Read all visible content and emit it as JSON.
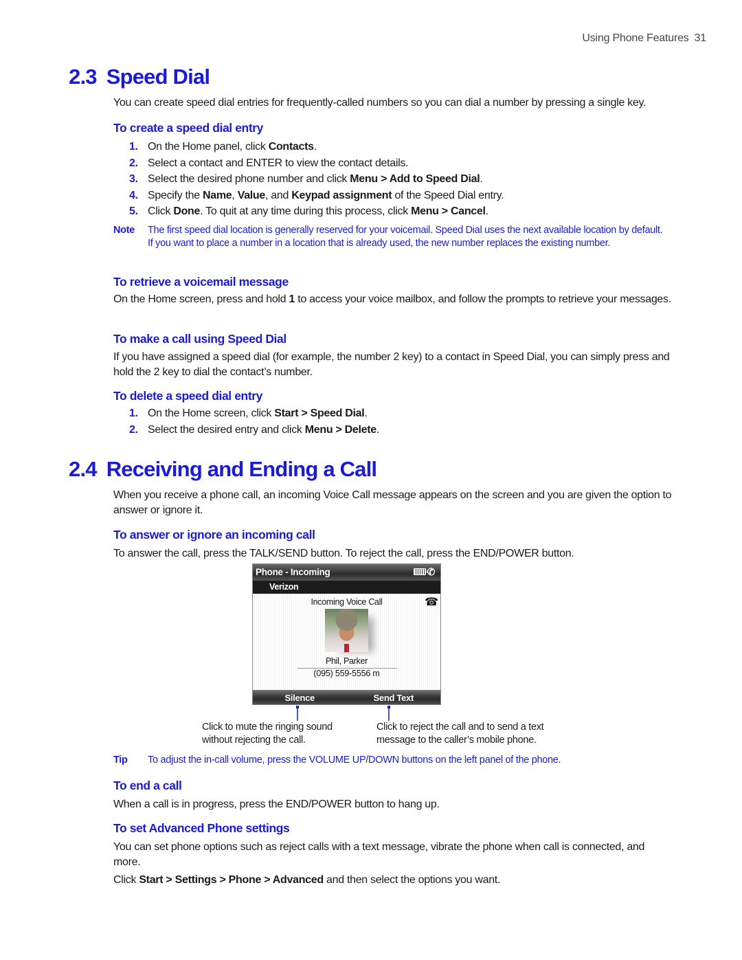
{
  "header": {
    "chapter": "Using Phone Features",
    "page": "31"
  },
  "sections": [
    {
      "number": "2.3",
      "title": "Speed Dial",
      "intro": "You can create speed dial entries for frequently-called numbers so you can dial a number by pressing a single key.",
      "create": {
        "heading": "To create a speed dial entry",
        "steps": [
          {
            "n": "1.",
            "parts": [
              [
                "On the Home panel, click ",
                false
              ],
              [
                "Contacts",
                true
              ],
              [
                ".",
                false
              ]
            ]
          },
          {
            "n": "2.",
            "parts": [
              [
                "Select a contact and ENTER to view the contact details.",
                false
              ]
            ]
          },
          {
            "n": "3.",
            "parts": [
              [
                "Select the desired phone number and click ",
                false
              ],
              [
                "Menu > Add to Speed Dial",
                true
              ],
              [
                ".",
                false
              ]
            ]
          },
          {
            "n": "4.",
            "parts": [
              [
                "Specify the ",
                false
              ],
              [
                "Name",
                true
              ],
              [
                ", ",
                false
              ],
              [
                "Value",
                true
              ],
              [
                ", and ",
                false
              ],
              [
                "Keypad assignment",
                true
              ],
              [
                " of the Speed Dial entry.",
                false
              ]
            ]
          },
          {
            "n": "5.",
            "parts": [
              [
                "Click ",
                false
              ],
              [
                "Done",
                true
              ],
              [
                ". To quit at any time during this process, click ",
                false
              ],
              [
                "Menu > Cancel",
                true
              ],
              [
                ".",
                false
              ]
            ]
          }
        ],
        "note_label": "Note",
        "note": "The first speed dial location is generally reserved for your voicemail. Speed Dial uses the next available location by default. If you want to place a number in a location that is already used, the new number replaces the existing number."
      },
      "voicemail": {
        "heading": "To retrieve a voicemail message",
        "parts": [
          [
            "On the Home screen, press and hold ",
            false
          ],
          [
            "1",
            true
          ],
          [
            " to access your voice mailbox, and follow the prompts to retrieve your messages.",
            false
          ]
        ]
      },
      "make_call": {
        "heading": "To make a call using Speed Dial",
        "text": "If you have assigned a speed dial (for example, the number 2 key) to a contact in Speed Dial, you can simply press and hold the 2 key to dial the contact’s number."
      },
      "delete": {
        "heading": "To delete a speed dial entry",
        "steps": [
          {
            "n": "1.",
            "parts": [
              [
                "On the Home screen, click ",
                false
              ],
              [
                "Start > Speed Dial",
                true
              ],
              [
                ".",
                false
              ]
            ]
          },
          {
            "n": "2.",
            "parts": [
              [
                "Select the desired entry and click ",
                false
              ],
              [
                "Menu > Delete",
                true
              ],
              [
                ".",
                false
              ]
            ]
          }
        ]
      }
    },
    {
      "number": "2.4",
      "title": "Receiving and Ending a Call",
      "intro": "When you receive a phone call, an incoming Voice Call message appears on the screen and you are given the option to answer or ignore it.",
      "answer": {
        "heading": "To answer or ignore an incoming call",
        "text": "To answer the call, press the TALK/SEND button. To reject the call, press the END/POWER button."
      },
      "phone_screen": {
        "title": "Phone - Incoming",
        "carrier": "Verizon",
        "status_icons": [
          "battery-icon",
          "phone-handset-icon"
        ],
        "incoming_label": "Incoming Voice Call",
        "call_icon": "incoming-call-icon",
        "contact_name": "Phil, Parker",
        "contact_number": "(095) 559-5556 m",
        "softkey_left": "Silence",
        "softkey_right": "Send Text"
      },
      "callouts": {
        "left": [
          "Click to mute the ringing sound",
          "without rejecting the call."
        ],
        "right": [
          "Click to reject the call and to send a text",
          "message to the caller’s mobile phone."
        ]
      },
      "tip_label": "Tip",
      "tip": "To adjust the in-call volume, press the VOLUME UP/DOWN buttons on the left panel of the phone.",
      "end_call": {
        "heading": "To end a call",
        "text": "When a call is in progress, press the END/POWER button to hang up."
      },
      "advanced": {
        "heading": "To set Advanced Phone settings",
        "text": "You can set phone options such as reject calls with a text message, vibrate the phone when call is connected, and more.",
        "parts": [
          [
            "Click ",
            false
          ],
          [
            "Start > Settings > Phone > Advanced",
            true
          ],
          [
            " and then select the options you want.",
            false
          ]
        ]
      }
    }
  ],
  "colors": {
    "accent": "#1a1adb",
    "text": "#1a1a1a",
    "callout_line": "#3b5bd0"
  }
}
